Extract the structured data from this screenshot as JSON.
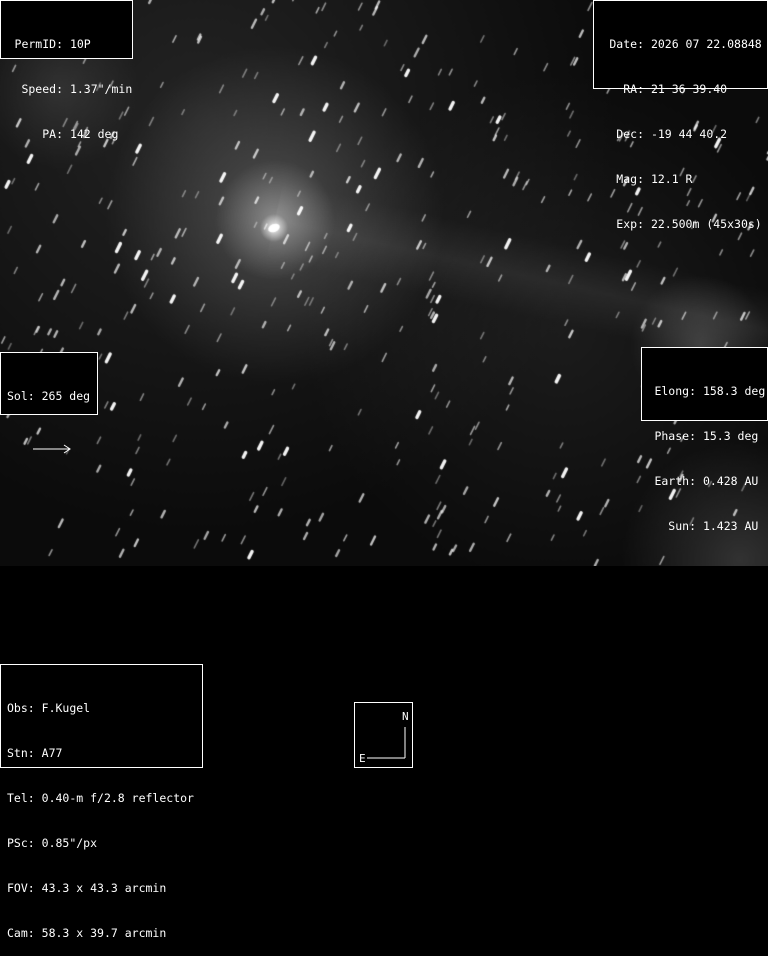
{
  "image": {
    "subject": "comet 10P star field",
    "colors": {
      "background": "#000000",
      "text": "#ffffff",
      "border": "#ffffff"
    }
  },
  "overlays": {
    "perm": [
      {
        "key": "PermID:",
        "value": "10P"
      },
      {
        "key": "Speed:",
        "value": "1.37\"/min"
      },
      {
        "key": "PA:",
        "value": "142 deg"
      }
    ],
    "ephemeris": [
      {
        "key": "Date:",
        "value": "2026 07 22.08848"
      },
      {
        "key": "RA:",
        "value": "21 36 39.40"
      },
      {
        "key": "Dec:",
        "value": "-19 44 40.2"
      },
      {
        "key": "Mag:",
        "value": "12.1 R"
      },
      {
        "key": "Exp:",
        "value": "22.500m (45x30s)"
      }
    ],
    "sol": {
      "label": "Sol: 265 deg"
    },
    "geometry": [
      {
        "key": "Elong:",
        "value": "158.3 deg"
      },
      {
        "key": "Phase:",
        "value": "15.3 deg"
      },
      {
        "key": "Earth:",
        "value": "0.428 AU"
      },
      {
        "key": "Sun:",
        "value": "1.423 AU"
      }
    ],
    "observer": [
      {
        "key": "Obs:",
        "value": "F.Kugel"
      },
      {
        "key": "Stn:",
        "value": "A77"
      },
      {
        "key": "Tel:",
        "value": "0.40-m f/2.8 reflector"
      },
      {
        "key": "PSc:",
        "value": "0.85\"/px"
      },
      {
        "key": "FOV:",
        "value": "43.3 x 43.3 arcmin"
      },
      {
        "key": "Cam:",
        "value": "58.3 x 39.7 arcmin"
      }
    ],
    "compass": {
      "north": "N",
      "east": "E"
    }
  }
}
